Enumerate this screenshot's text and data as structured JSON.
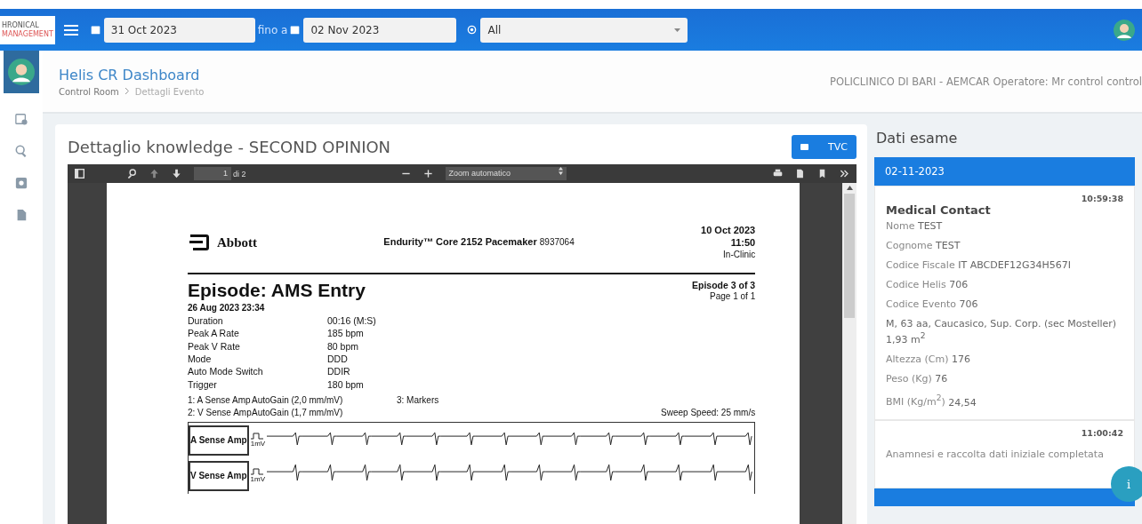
{
  "header": {
    "logo_lines": [
      "HRONICAL",
      "MANAGEMENT"
    ],
    "date_from": "31 Oct 2023",
    "separator": "fino a",
    "date_to": "02 Nov 2023",
    "location": "All"
  },
  "page_header": {
    "title": "Helis CR Dashboard",
    "breadcrumb": [
      "Control Room",
      "Dettagli Evento"
    ],
    "info": "POLICLINICO DI BARI - AEMCAR Operatore: Mr control control"
  },
  "card": {
    "title": "Dettaglio knowledge - SECOND OPINION",
    "tvc_button": "TVC"
  },
  "pdf_toolbar": {
    "page": "1",
    "page_count": "di 2",
    "zoom": "Zoom automatico"
  },
  "report": {
    "brand": "Abbott",
    "device": "Endurity™ Core 2152 Pacemaker",
    "serial": "8937064",
    "date": "10 Oct 2023",
    "time": "11:50",
    "setting": "In-Clinic",
    "title": "Episode: AMS Entry",
    "episode": "Episode 3 of 3",
    "page": "Page 1 of 1",
    "timestamp": "26 Aug 2023 23:34",
    "rows": [
      {
        "label": "Duration",
        "value": "00:16 (M:S)"
      },
      {
        "label": "Peak A Rate",
        "value": "185 bpm"
      },
      {
        "label": "Peak V Rate",
        "value": "80 bpm"
      },
      {
        "label": "Mode",
        "value": "DDD"
      },
      {
        "label": "Auto Mode Switch",
        "value": "DDIR"
      },
      {
        "label": "Trigger",
        "value": "180 bpm"
      }
    ],
    "legend": [
      {
        "channel": "1:  A Sense Amp",
        "gain": "AutoGain (2,0 mm/mV)",
        "extra": "3:  Markers"
      },
      {
        "channel": "2:  V Sense Amp",
        "gain": "AutoGain (1,7 mm/mV)",
        "extra": "Sweep Speed: 25 mm/s"
      }
    ],
    "strips": [
      {
        "label": "A Sense Amp",
        "scale": "1mV"
      },
      {
        "label": "V Sense Amp",
        "scale": "1mV"
      }
    ]
  },
  "side_panel": {
    "title": "Dati esame",
    "date": "02-11-2023",
    "entries": [
      {
        "time": "10:59:38",
        "heading": "Medical Contact",
        "fields": [
          {
            "label": "Nome",
            "value": "TEST"
          },
          {
            "label": "Cognome",
            "value": "TEST"
          },
          {
            "label": "Codice Fiscale",
            "value": "IT ABCDEF12G34H567I"
          },
          {
            "label": "Codice Helis",
            "value": "706"
          },
          {
            "label": "Codice Evento",
            "value": "706"
          },
          {
            "value": "M, 63 aa, Caucasico, Sup. Corp. (sec Mosteller) 1,93 m$^{2}$"
          },
          {
            "label": "Altezza (Cm)",
            "value": "176"
          },
          {
            "label": "Peso (Kg)",
            "value": "76"
          },
          {
            "label": "BMI (Kg/m$^{2}$)",
            "value": "24,54"
          }
        ]
      },
      {
        "time": "11:00:42",
        "text": "Anamnesi e raccolta dati iniziale completata"
      }
    ],
    "fab": "i"
  }
}
